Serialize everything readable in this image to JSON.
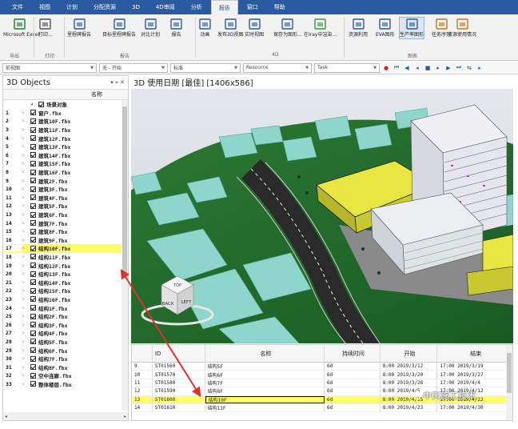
{
  "menu": {
    "tabs": [
      "文件",
      "视图",
      "计划",
      "分配资源",
      "3D",
      "4D审阅",
      "分析",
      "报告",
      "窗口",
      "帮助"
    ],
    "active_tab": "报告"
  },
  "ribbon": {
    "buttons": [
      {
        "id": "excel",
        "label": "Microsoft Excel"
      },
      {
        "id": "print",
        "label": "打印..."
      },
      {
        "id": "rpt1",
        "label": "里程碑报告"
      },
      {
        "id": "rpt2",
        "label": "目标里程碑报告"
      },
      {
        "id": "rpt3",
        "label": "对比计划"
      },
      {
        "id": "rpt4",
        "label": "报告"
      },
      {
        "id": "anim",
        "label": "动画"
      },
      {
        "id": "export3d",
        "label": "发布3D视图"
      },
      {
        "id": "snap",
        "label": "实时视图"
      },
      {
        "id": "saveimg",
        "label": "保存为图形..."
      },
      {
        "id": "iray",
        "label": "在Iray中渲染..."
      },
      {
        "id": "res",
        "label": "资源利用"
      },
      {
        "id": "eva",
        "label": "EVA图形"
      },
      {
        "id": "prod",
        "label": "生产率图形"
      },
      {
        "id": "task",
        "label": "任务序列"
      },
      {
        "id": "resuse",
        "label": "资源使用情况"
      }
    ],
    "groups": [
      "导出",
      "打印",
      "报告",
      "4D",
      "图表"
    ]
  },
  "toolbar": {
    "combo1": "前视图",
    "combo2": "无 - 开始",
    "combo3": "标准",
    "combo4": "Resource",
    "combo5": "Task"
  },
  "left_panel": {
    "title": "3D Objects",
    "pin": "▾ ⌖ ✕",
    "column_header": "名称",
    "root_label": "场景对象",
    "items": [
      {
        "n": "1",
        "name": "窗户.fbx"
      },
      {
        "n": "2",
        "name": "建筑10F.fbx"
      },
      {
        "n": "3",
        "name": "建筑11F.fbx"
      },
      {
        "n": "4",
        "name": "建筑12F.fbx"
      },
      {
        "n": "5",
        "name": "建筑13F.fbx"
      },
      {
        "n": "6",
        "name": "建筑14F.fbx"
      },
      {
        "n": "7",
        "name": "建筑15F.fbx"
      },
      {
        "n": "8",
        "name": "建筑16F.fbx"
      },
      {
        "n": "9",
        "name": "建筑2F.fbx"
      },
      {
        "n": "10",
        "name": "建筑3F.fbx"
      },
      {
        "n": "11",
        "name": "建筑4F.fbx"
      },
      {
        "n": "12",
        "name": "建筑5F.fbx"
      },
      {
        "n": "13",
        "name": "建筑6F.fbx"
      },
      {
        "n": "14",
        "name": "建筑7F.fbx"
      },
      {
        "n": "15",
        "name": "建筑8F.fbx"
      },
      {
        "n": "16",
        "name": "建筑9F.fbx"
      },
      {
        "n": "17",
        "name": "结构10F.fbx"
      },
      {
        "n": "18",
        "name": "结构11F.fbx"
      },
      {
        "n": "19",
        "name": "结构12F.fbx"
      },
      {
        "n": "20",
        "name": "结构13F.fbx"
      },
      {
        "n": "21",
        "name": "结构14F.fbx"
      },
      {
        "n": "22",
        "name": "结构15F.fbx"
      },
      {
        "n": "23",
        "name": "结构16F.fbx"
      },
      {
        "n": "24",
        "name": "结构1F.fbx"
      },
      {
        "n": "25",
        "name": "结构2F.fbx"
      },
      {
        "n": "26",
        "name": "结构3F.fbx"
      },
      {
        "n": "27",
        "name": "结构4F.fbx"
      },
      {
        "n": "28",
        "name": "结构5F.fbx"
      },
      {
        "n": "29",
        "name": "结构6F.fbx"
      },
      {
        "n": "30",
        "name": "结构7F.fbx"
      },
      {
        "n": "31",
        "name": "结构8F.fbx"
      },
      {
        "n": "32",
        "name": "空中连廊.fbx"
      },
      {
        "n": "33",
        "name": "整体楼层.fbx"
      }
    ],
    "highlighted": "17"
  },
  "viewport": {
    "title": "3D 使用日期 [最佳] [1406x586]",
    "cube_faces": [
      "BACK",
      "LEFT",
      "TOP"
    ]
  },
  "task_table": {
    "headers": [
      "ID",
      "名称",
      "持续时间",
      "开始",
      "结束"
    ],
    "rows": [
      {
        "row": "9",
        "id": "ST01560",
        "name": "结构5F",
        "dur": "6d",
        "start": "8:00 2019/3/12",
        "end": "17:00 2019/3/19"
      },
      {
        "row": "10",
        "id": "ST01570",
        "name": "结构6F",
        "dur": "6d",
        "start": "8:00 2019/3/20",
        "end": "17:00 2019/3/27"
      },
      {
        "row": "11",
        "id": "ST01580",
        "name": "结构7F",
        "dur": "6d",
        "start": "8:00 2019/3/28",
        "end": "17:00 2019/4/4"
      },
      {
        "row": "12",
        "id": "ST01590",
        "name": "结构8F",
        "dur": "6d",
        "start": "8:00 2019/4/5",
        "end": "17:00 2019/4/12"
      },
      {
        "row": "13",
        "id": "ST01600",
        "name": "结构10F",
        "dur": "6d",
        "start": "8:00 2019/4/15",
        "end": "17:00 2019/4/22"
      },
      {
        "row": "14",
        "id": "ST01610",
        "name": "结构11F",
        "dur": "6d",
        "start": "8:00 2019/4/23",
        "end": "17:00 2019/4/30"
      }
    ],
    "highlighted": "13"
  },
  "watermark": "中天施工技术",
  "colors": {
    "menubar": "#2a5aa0",
    "highlight": "#ffff66",
    "arrow": "#e03030",
    "ground": "#1f6b2a",
    "sky": "#d8dce0"
  }
}
